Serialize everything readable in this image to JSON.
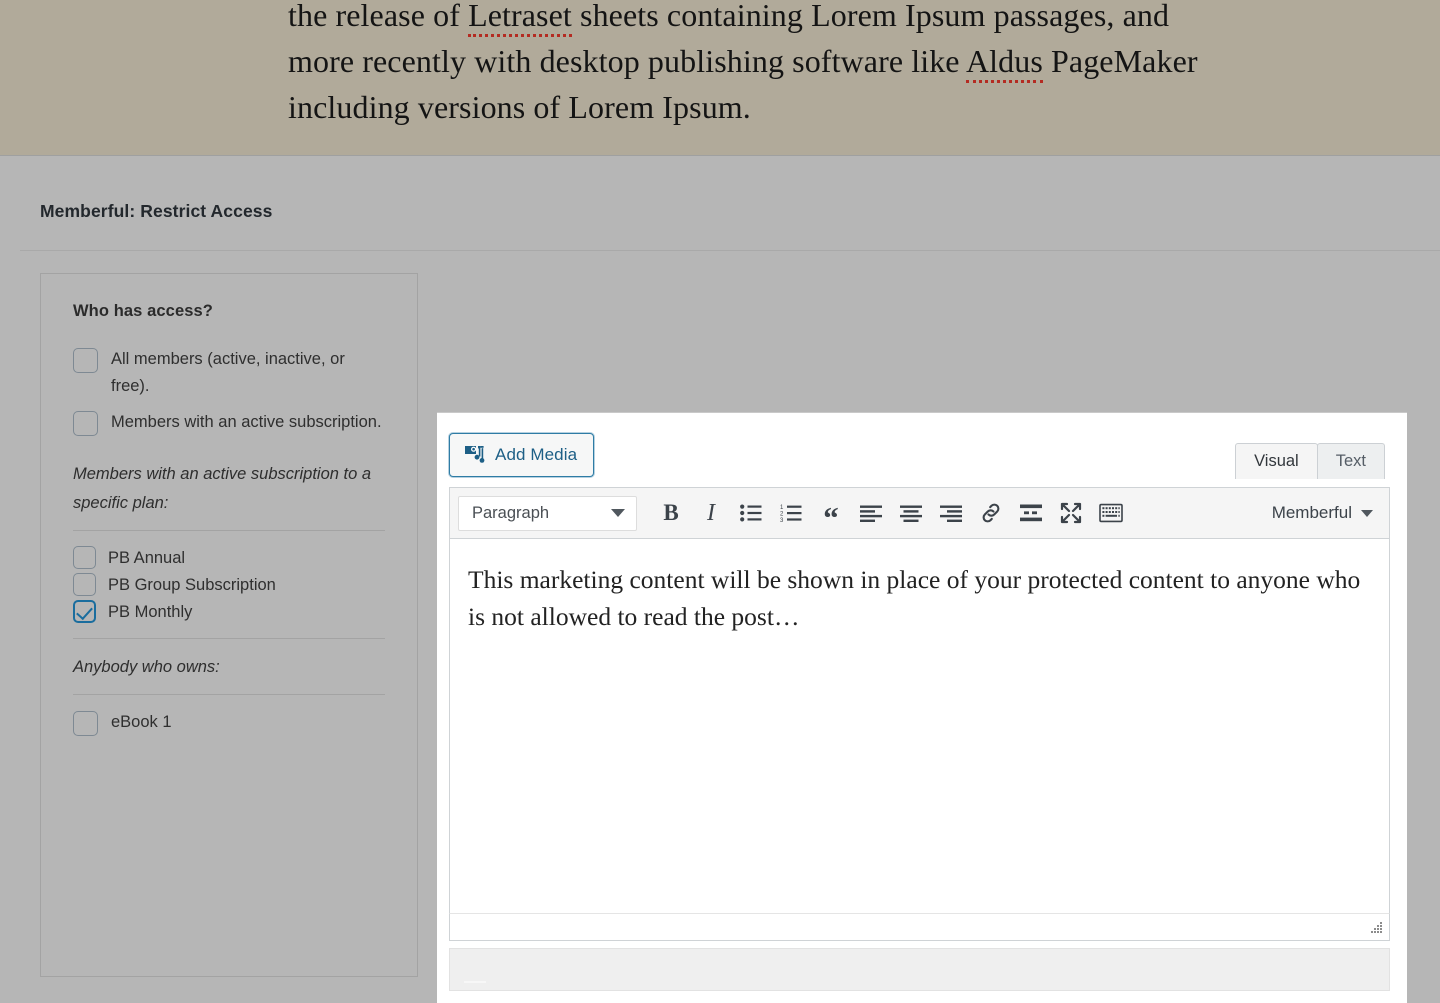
{
  "excerpt": {
    "line1_a": "the release of ",
    "line1_spell": "Letraset",
    "line1_b": " sheets containing Lorem Ipsum passages, and",
    "line2_a": "more recently with desktop publishing software like ",
    "line2_spell": "Aldus",
    "line2_b": " PageMaker",
    "line3": "including versions of Lorem Ipsum."
  },
  "metabox": {
    "title": "Memberful: Restrict Access"
  },
  "access_panel": {
    "heading": "Who has access?",
    "options": [
      {
        "label": "All members (active, inactive, or free).",
        "checked": false
      },
      {
        "label": "Members with an active subscription.",
        "checked": false
      }
    ],
    "plan_group_note": "Members with an active subscription to a specific plan:",
    "plans": [
      {
        "label": "PB Annual",
        "checked": false
      },
      {
        "label": "PB Group Subscription",
        "checked": false
      },
      {
        "label": "PB Monthly",
        "checked": true
      }
    ],
    "download_group_note": "Anybody who owns:",
    "downloads": [
      {
        "label": "eBook 1",
        "checked": false
      }
    ],
    "checked_color": "#1a6d9e",
    "border_color": "#7e8993"
  },
  "editor": {
    "add_media_label": "Add Media",
    "add_media_icon": "media-icon",
    "tabs": [
      {
        "label": "Visual",
        "active": true
      },
      {
        "label": "Text",
        "active": false
      }
    ],
    "format_select": {
      "value": "Paragraph",
      "icon": "chevron-down-icon"
    },
    "toolbar_buttons": [
      {
        "name": "bold-button",
        "glyph": "B"
      },
      {
        "name": "italic-button",
        "glyph": "I"
      },
      {
        "name": "bulleted-list-button",
        "glyph": ""
      },
      {
        "name": "numbered-list-button",
        "glyph": ""
      },
      {
        "name": "blockquote-button",
        "glyph": "“"
      },
      {
        "name": "align-left-button",
        "glyph": ""
      },
      {
        "name": "align-center-button",
        "glyph": ""
      },
      {
        "name": "align-right-button",
        "glyph": ""
      },
      {
        "name": "insert-link-button",
        "glyph": ""
      },
      {
        "name": "read-more-button",
        "glyph": ""
      },
      {
        "name": "fullscreen-button",
        "glyph": ""
      },
      {
        "name": "toolbar-toggle-button",
        "glyph": ""
      }
    ],
    "memberful_menu_label": "Memberful",
    "content_paragraph": "This marketing content will be shown in place of your protected content to anyone who is not allowed to read the post…",
    "accent_color": "#2e7ca5",
    "link_color": "#1d5f86"
  }
}
